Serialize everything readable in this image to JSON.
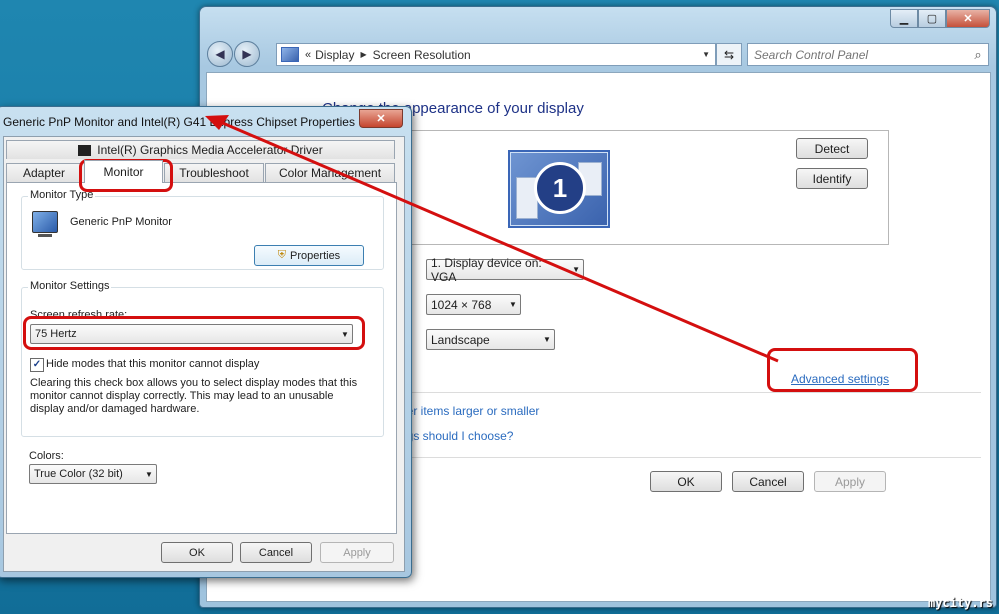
{
  "main_window": {
    "address": {
      "crumbs": [
        "Display",
        "Screen Resolution"
      ]
    },
    "search": {
      "placeholder": "Search Control Panel"
    },
    "heading": "Change the appearance of your display",
    "monitor_number": "1",
    "buttons": {
      "detect": "Detect",
      "identify": "Identify",
      "ok": "OK",
      "cancel": "Cancel",
      "apply": "Apply"
    },
    "display_combo": "1. Display device on: VGA",
    "resolution_combo": "1024 × 768",
    "orientation_combo": "Landscape",
    "advanced_link": "Advanced settings",
    "partial_links": [
      "her items larger or smaller",
      "ngs should I choose?"
    ]
  },
  "dialog": {
    "title": "Generic PnP Monitor and Intel(R) G41 Express Chipset Properties",
    "close": "✕",
    "tabs_top": [
      "Intel(R) Graphics Media Accelerator Driver"
    ],
    "tabs": [
      "Adapter",
      "Monitor",
      "Troubleshoot",
      "Color Management"
    ],
    "monitor_type": {
      "group_title": "Monitor Type",
      "name": "Generic PnP Monitor",
      "properties_button": "Properties"
    },
    "monitor_settings": {
      "group_title": "Monitor Settings",
      "refresh_label": "Screen refresh rate:",
      "refresh_value": "75 Hertz",
      "hide_modes_checked": true,
      "hide_modes_label": "Hide modes that this monitor cannot display",
      "description": "Clearing this check box allows you to select display modes that this monitor cannot display correctly. This may lead to an unusable display and/or damaged hardware."
    },
    "colors": {
      "label": "Colors:",
      "value": "True Color (32 bit)"
    },
    "buttons": {
      "ok": "OK",
      "cancel": "Cancel",
      "apply": "Apply"
    }
  },
  "window_controls": {
    "minimize": "▁",
    "maximize": "▢",
    "close": "✕"
  },
  "watermark": "mycity.rs",
  "accent_colors": {
    "highlight": "#d40f0f",
    "link": "#2a6bbf",
    "heading": "#1e3287"
  }
}
